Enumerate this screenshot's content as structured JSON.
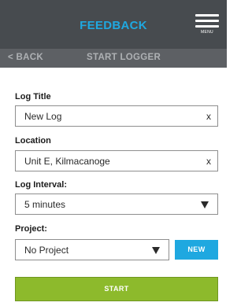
{
  "header": {
    "brand": "FEEDBACK",
    "menu_label": "MENU",
    "back_label": "< BACK",
    "subtitle": "START LOGGER"
  },
  "form": {
    "log_title": {
      "label": "Log Title",
      "value": "New Log",
      "clear": "x"
    },
    "location": {
      "label": "Location",
      "value": "Unit E, Kilmacanoge",
      "clear": "x"
    },
    "log_interval": {
      "label": "Log Interval:",
      "value": "5 minutes"
    },
    "project": {
      "label": "Project:",
      "value": "No Project",
      "new_label": "NEW"
    },
    "start_label": "START"
  },
  "colors": {
    "accent": "#1fa8e0",
    "header_bg": "#474b4f",
    "subbar_bg": "#5d6064",
    "start_bg": "#8dba2c"
  }
}
